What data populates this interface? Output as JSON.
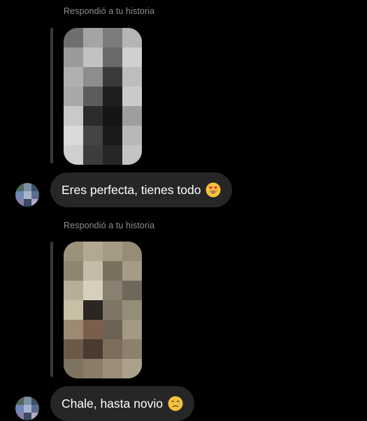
{
  "messages": [
    {
      "reply_label": "Respondió a tu historia",
      "story_thumbnail_icon": "pixelated-story-image-grayscale",
      "text": "Eres perfecta, tienes todo",
      "emoji_icon": "heart-eyes-emoji"
    },
    {
      "reply_label": "Respondió a tu historia",
      "story_thumbnail_icon": "pixelated-story-image-beige",
      "text": "Chale, hasta novio",
      "emoji_icon": "sad-tear-emoji"
    }
  ],
  "sender_avatar_icon": "pixelated-avatar",
  "colors": {
    "background": "#000000",
    "bubble": "#262626",
    "reply_label": "#8e8e93",
    "reply_bar": "#3a3a3c"
  }
}
